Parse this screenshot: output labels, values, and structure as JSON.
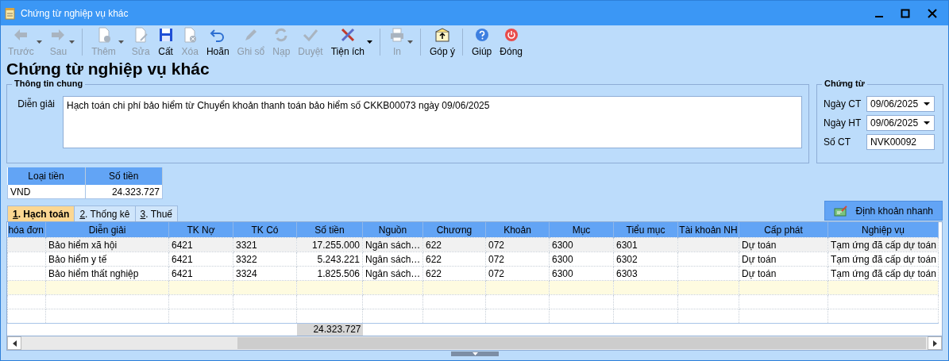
{
  "window": {
    "title": "Chứng từ nghiệp vụ khác"
  },
  "toolbar": [
    {
      "kind": "button",
      "label": "Trước",
      "disabled": true,
      "dropdown": true
    },
    {
      "kind": "button",
      "label": "Sau",
      "disabled": true,
      "dropdown": true
    },
    {
      "kind": "separator"
    },
    {
      "kind": "button",
      "label": "Thêm",
      "disabled": true,
      "dropdown": true
    },
    {
      "kind": "button",
      "label": "Sửa",
      "disabled": true,
      "dropdown": false
    },
    {
      "kind": "button",
      "label": "Cất",
      "disabled": false,
      "dropdown": false
    },
    {
      "kind": "button",
      "label": "Xóa",
      "disabled": true,
      "dropdown": false
    },
    {
      "kind": "button",
      "label": "Hoãn",
      "disabled": false,
      "dropdown": false
    },
    {
      "kind": "button",
      "label": "Ghi sổ",
      "disabled": true,
      "dropdown": false
    },
    {
      "kind": "button",
      "label": "Nạp",
      "disabled": true,
      "dropdown": false
    },
    {
      "kind": "button",
      "label": "Duyệt",
      "disabled": true,
      "dropdown": false
    },
    {
      "kind": "button",
      "label": "Tiện ích",
      "disabled": false,
      "dropdown": true
    },
    {
      "kind": "separator"
    },
    {
      "kind": "button",
      "label": "In",
      "disabled": true,
      "dropdown": true
    },
    {
      "kind": "separator"
    },
    {
      "kind": "button",
      "label": "Góp ý",
      "disabled": false,
      "dropdown": false
    },
    {
      "kind": "separator"
    },
    {
      "kind": "button",
      "label": "Giúp",
      "disabled": false,
      "dropdown": false
    },
    {
      "kind": "button",
      "label": "Đóng",
      "disabled": false,
      "dropdown": false
    }
  ],
  "heading": "Chứng từ nghiệp vụ khác",
  "general": {
    "title": "Thông tin chung",
    "label": "Diễn giải",
    "value": "Hạch toán chi phí bảo hiểm từ Chuyển khoản thanh toán bảo hiểm số CKKB00073 ngày 09/06/2025"
  },
  "voucher": {
    "title": "Chứng từ",
    "fields": [
      {
        "label": "Ngày CT",
        "value": "09/06/2025",
        "kind": "date"
      },
      {
        "label": "Ngày HT",
        "value": "09/06/2025",
        "kind": "date"
      },
      {
        "label": "Số CT",
        "value": "NVK00092",
        "kind": "text"
      }
    ]
  },
  "currency": {
    "columns": [
      "Loại tiền",
      "Số tiền"
    ],
    "rows": [
      [
        "VND",
        "24.323.727"
      ]
    ]
  },
  "tabs": [
    {
      "number": "1",
      "label": ". Hạch toán",
      "selected": true
    },
    {
      "number": "2",
      "label": ". Thống kê",
      "selected": false
    },
    {
      "number": "3",
      "label": ". Thuế",
      "selected": false
    }
  ],
  "quick_button": "Định khoản nhanh",
  "table": {
    "columns": [
      "hóa đơn",
      "Diễn giải",
      "TK Nợ",
      "TK Có",
      "Số tiền",
      "Nguồn",
      "Chương",
      "Khoản",
      "Mục",
      "Tiểu mục",
      "Tài khoản NH",
      "Cấp phát",
      "Nghiệp vụ"
    ],
    "rows": [
      {
        "kind": "data",
        "selected": true,
        "cells": [
          "",
          "Bảo hiểm xã hội",
          "6421",
          "3321",
          "17.255.000",
          "Ngân sách…",
          "622",
          "072",
          "6300",
          "6301",
          "",
          "Dự toán",
          "Tạm ứng đã cấp dự toán"
        ]
      },
      {
        "kind": "data",
        "selected": false,
        "cells": [
          "",
          "Bảo hiểm y tế",
          "6421",
          "3322",
          "5.243.221",
          "Ngân sách…",
          "622",
          "072",
          "6300",
          "6302",
          "",
          "Dự toán",
          "Tạm ứng đã cấp dự toán"
        ]
      },
      {
        "kind": "data",
        "selected": false,
        "cells": [
          "",
          "Bảo hiểm thất nghiệp",
          "6421",
          "3324",
          "1.825.506",
          "Ngân sách…",
          "622",
          "072",
          "6300",
          "6303",
          "",
          "Dự toán",
          "Tạm ứng đã cấp dự toán"
        ]
      },
      {
        "kind": "new",
        "selected": false,
        "cells": []
      },
      {
        "kind": "empty",
        "selected": false,
        "cells": []
      },
      {
        "kind": "empty",
        "selected": false,
        "cells": []
      }
    ],
    "total": "24.323.727"
  }
}
